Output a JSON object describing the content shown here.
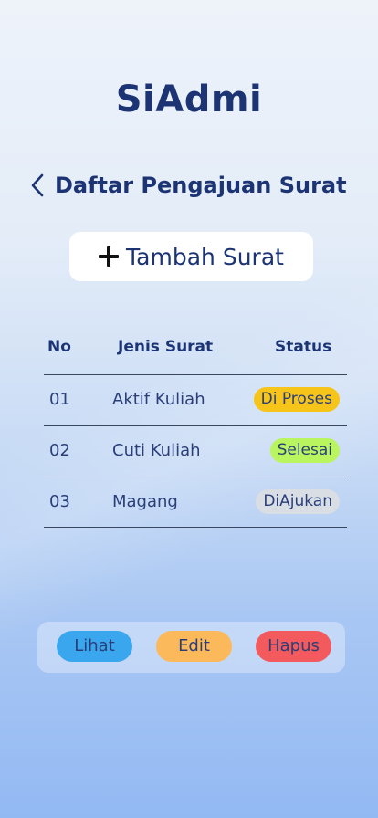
{
  "app": {
    "title": "SiAdmi"
  },
  "header": {
    "title": "Daftar Pengajuan Surat",
    "back_icon": "chevron-left-icon"
  },
  "add_button": {
    "label": "Tambah Surat",
    "icon": "plus-icon"
  },
  "table": {
    "headers": {
      "no": "No",
      "jenis": "Jenis Surat",
      "status": "Status"
    },
    "rows": [
      {
        "no": "01",
        "jenis": "Aktif Kuliah",
        "status": "Di Proses",
        "status_color": "#f7c41a"
      },
      {
        "no": "02",
        "jenis": "Cuti Kuliah",
        "status": "Selesai",
        "status_color": "#b9f55e"
      },
      {
        "no": "03",
        "jenis": "Magang",
        "status": "DiAjukan",
        "status_color": "#d9dde4"
      }
    ]
  },
  "actions": {
    "lihat": {
      "label": "Lihat",
      "color": "#3aa6ee"
    },
    "edit": {
      "label": "Edit",
      "color": "#fcb95b"
    },
    "hapus": {
      "label": "Hapus",
      "color": "#f25a5e"
    }
  },
  "colors": {
    "primary_text": "#1c3473",
    "divider": "#3a4560"
  }
}
